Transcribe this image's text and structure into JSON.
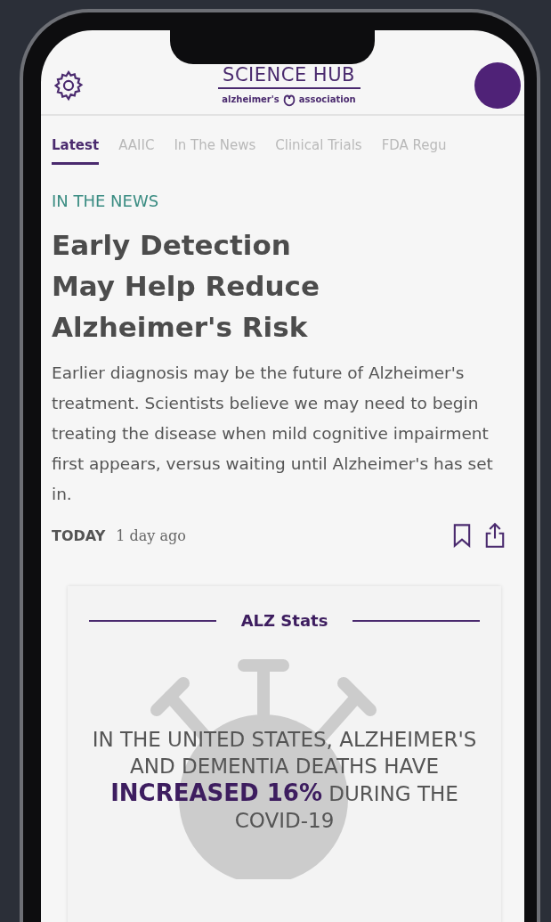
{
  "header": {
    "title": "SCIENCE HUB",
    "brand_left": "alzheimer's",
    "brand_right": "association"
  },
  "tabs": [
    {
      "label": "Latest",
      "selected": true
    },
    {
      "label": "AAIIC",
      "selected": false
    },
    {
      "label": "In The News",
      "selected": false
    },
    {
      "label": "Clinical Trials",
      "selected": false
    },
    {
      "label": "FDA Regu",
      "selected": false
    }
  ],
  "article": {
    "category": "IN THE NEWS",
    "headline": "Early Detection May Help Reduce Alzheimer's Risk",
    "body": "Earlier diagnosis may be the future of Alzheimer's treatment. Scientists believe we may need to begin treating the disease when mild cognitive impairment first appears, versus waiting until Alzheimer's has set in.",
    "tag": "TODAY",
    "time": "1 day ago"
  },
  "stats": {
    "title": "ALZ Stats",
    "text": "IN THE UNITED STATES, ALZHEIMER'S AND DEMENTIA DEATHS HAVE **INCREASED 16%** DURING THE COVID-19"
  }
}
